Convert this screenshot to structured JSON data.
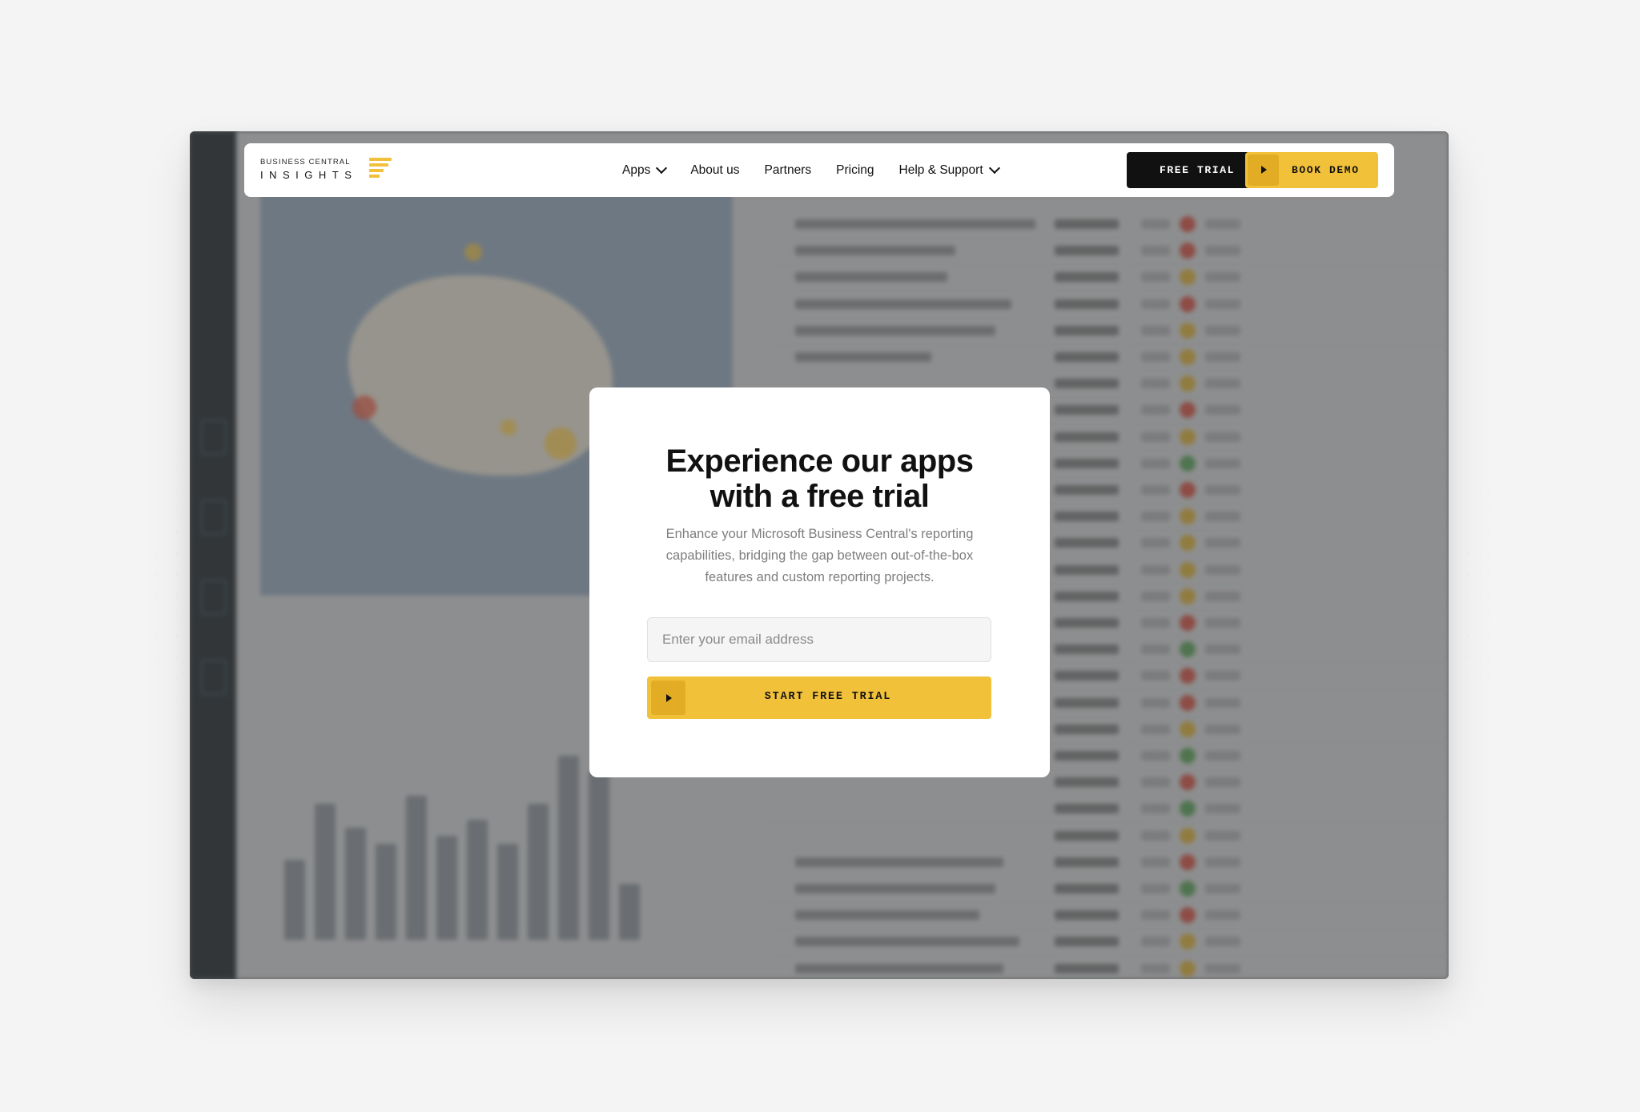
{
  "brand": {
    "line1": "BUSINESS CENTRAL",
    "line2": "INSIGHTS",
    "accent_color": "#f2c13a"
  },
  "nav": {
    "items": [
      {
        "label": "Apps",
        "has_dropdown": true
      },
      {
        "label": "About us",
        "has_dropdown": false
      },
      {
        "label": "Partners",
        "has_dropdown": false
      },
      {
        "label": "Pricing",
        "has_dropdown": false
      },
      {
        "label": "Help & Support",
        "has_dropdown": true
      }
    ],
    "free_trial_label": "FREE TRIAL",
    "book_demo_label": "BOOK DEMO"
  },
  "modal": {
    "title_line1": "Experience our apps",
    "title_line2": "with a free trial",
    "description": "Enhance your Microsoft Business Central's reporting capabilities, bridging the gap between out-of-the-box features and custom reporting projects.",
    "email_placeholder": "Enter your email address",
    "email_value": "",
    "cta_label": "START FREE TRIAL"
  },
  "colors": {
    "background": "#f4f4f4",
    "dark_button": "#111111",
    "accent": "#f2c13a",
    "accent_dark": "#e2ad24"
  }
}
